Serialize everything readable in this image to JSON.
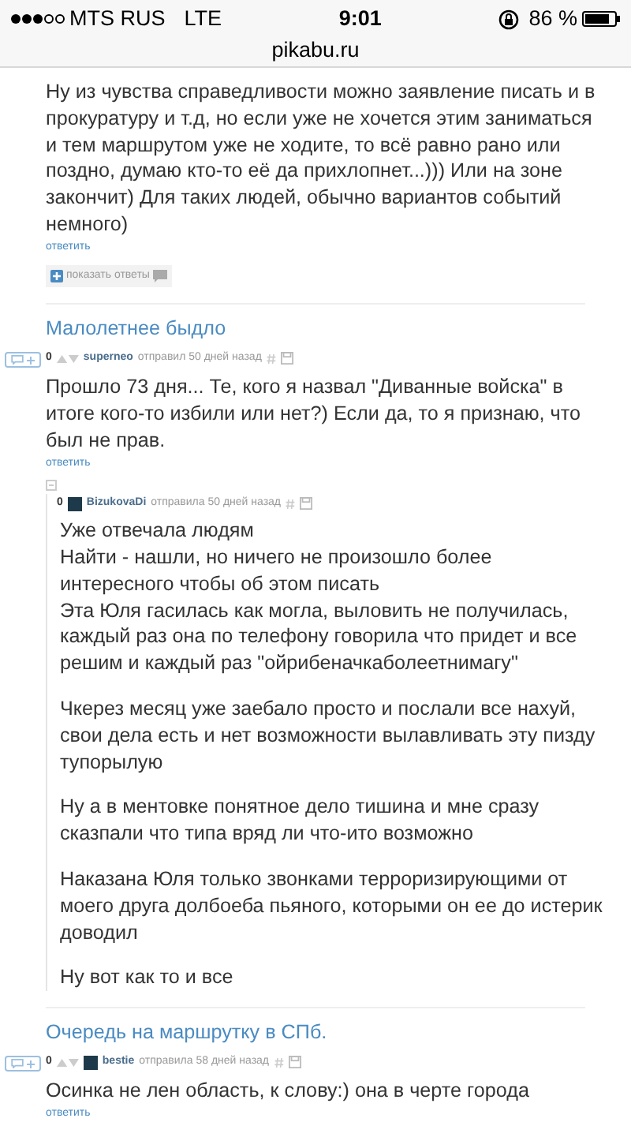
{
  "status_bar": {
    "carrier": "MTS RUS",
    "network": "LTE",
    "time": "9:01",
    "battery": "86 %",
    "url": "pikabu.ru"
  },
  "top_comment": {
    "text": "Ну из чувства справедливости можно заявление писать и в прокуратуру и т.д, но если уже не хочется этим заниматься и тем маршрутом уже не ходите, то всё равно рано или поздно, думаю кто-то её да прихлопнет...))) Или на зоне закончит) Для таких людей, обычно вариантов событий немного)",
    "reply": "ответить",
    "show_replies": "показать ответы"
  },
  "posts": [
    {
      "title": "Малолетнее быдло",
      "comment": {
        "rating": "0",
        "author": "superneo",
        "avatar": false,
        "meta": "отправил 50 дней назад",
        "text": "Прошло 73 дня... Те, кого я назвал \"Диванные войска\" в итоге кого-то избили или нет?) Если да, то я признаю, что был не прав.",
        "reply": "ответить",
        "replies": [
          {
            "rating": "0",
            "author": "BizukovaDi",
            "avatar": true,
            "meta": "отправила 50 дней назад",
            "paragraphs": [
              [
                "Уже отвечала людям",
                "Найти - нашли, но ничего не произошло более интересного чтобы об этом писать",
                "Эта Юля гасилась как могла, выловить не получилась, каждый раз она по телефону говорила что придет и все решим и каждый раз \"ойрибеначкаболеетнимагу\""
              ],
              [
                "Чкерез месяц уже заебало просто и послали все нахуй, свои дела есть и нет возможности вылавливать эту пизду тупорылую"
              ],
              [
                "Ну а в ментовке понятное дело тишина и мне сразу сказпали что типа вряд ли что-ито возможно"
              ],
              [
                "Наказана Юля только звонками терроризирующими от моего друга долбоеба пьяного, которыми он ее до истерик доводил"
              ],
              [
                "Ну вот как то и все"
              ]
            ]
          }
        ]
      }
    },
    {
      "title": "Очередь на маршрутку в СПб.",
      "comment": {
        "rating": "0",
        "author": "bestie",
        "avatar": true,
        "meta": "отправила 58 дней назад",
        "text": "Осинка не лен область, к слову:) она в черте города",
        "reply": "ответить"
      }
    }
  ]
}
